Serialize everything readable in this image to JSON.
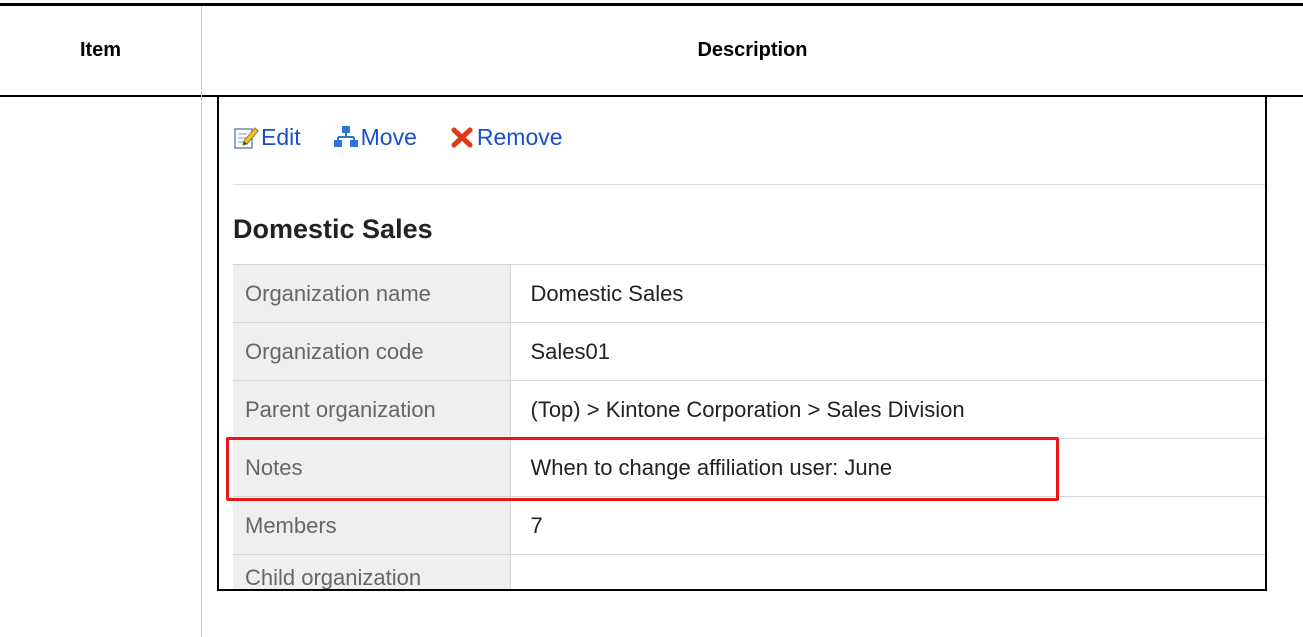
{
  "header": {
    "item": "Item",
    "description": "Description"
  },
  "toolbar": {
    "edit": {
      "label": "Edit",
      "icon": "edit-pencil-icon"
    },
    "move": {
      "label": "Move",
      "icon": "org-tree-icon"
    },
    "remove": {
      "label": "Remove",
      "icon": "red-x-icon"
    }
  },
  "org": {
    "title": "Domestic Sales"
  },
  "rows": [
    {
      "label": "Organization name",
      "value": "Domestic Sales"
    },
    {
      "label": "Organization code",
      "value": "Sales01"
    },
    {
      "label": "Parent organization",
      "value": "(Top) > Kintone Corporation > Sales Division"
    },
    {
      "label": "Notes",
      "value": "When to change affiliation user: June"
    },
    {
      "label": "Members",
      "value": "7"
    },
    {
      "label": "Child organization",
      "value": ""
    }
  ],
  "colors": {
    "link": "#1a4fcc",
    "highlight": "#e8151b",
    "label_bg": "#efefef"
  }
}
